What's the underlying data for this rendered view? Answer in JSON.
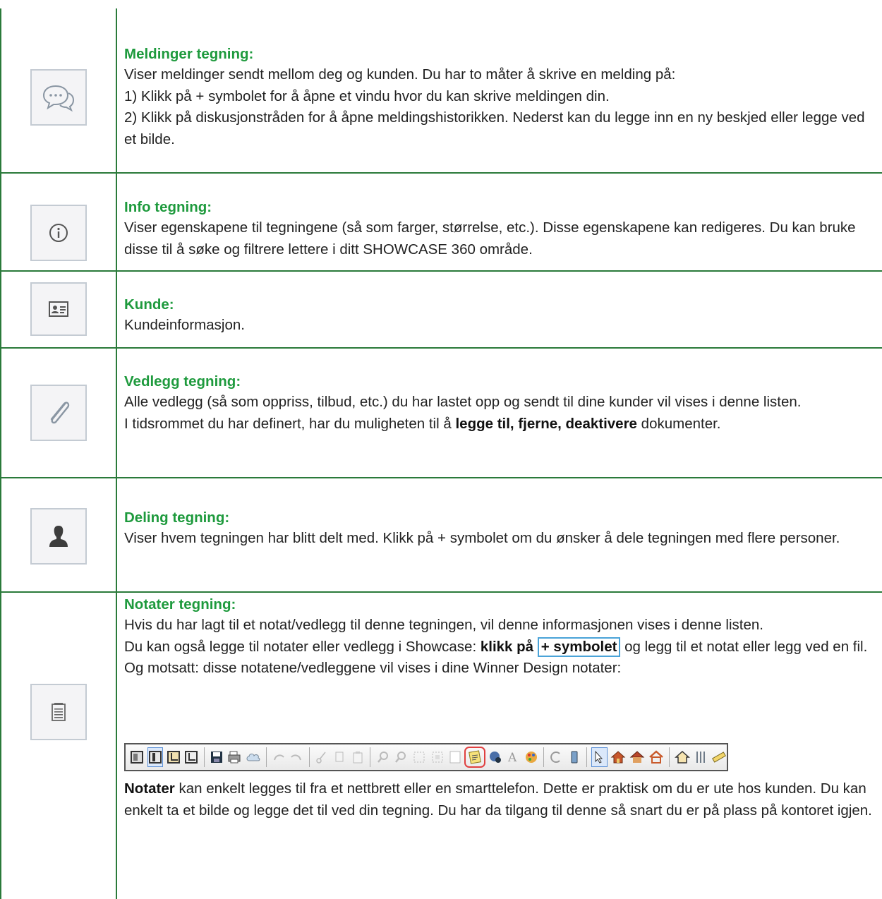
{
  "rows": [
    {
      "icon": "chat-bubbles-icon",
      "heading": "Meldinger tegning:",
      "lines": [
        "Viser meldinger sendt mellom deg og kunden. Du har to måter å skrive en melding på:",
        "1) Klikk på + symbolet for å åpne et vindu hvor du kan skrive meldingen din.",
        "2) Klikk på diskusjonstråden for å åpne meldingshistorikken. Nederst kan du legge inn en ny beskjed eller legge ved et bilde."
      ]
    },
    {
      "icon": "info-icon",
      "heading": "Info tegning:",
      "lines": [
        "Viser egenskapene til tegningene (så som farger, størrelse, etc.). Disse egenskapene kan redigeres. Du kan bruke disse til å søke og filtrere lettere i ditt SHOWCASE 360 område."
      ]
    },
    {
      "icon": "contact-card-icon",
      "heading": "Kunde:",
      "lines": [
        "Kundeinformasjon."
      ]
    },
    {
      "icon": "paperclip-icon",
      "heading": "Vedlegg tegning:",
      "line1": "Alle vedlegg (så som oppriss, tilbud, etc.) du har lastet opp og sendt til dine kunder vil vises i denne listen.",
      "line2_pre": "I tidsrommet du har definert, har du muligheten til å ",
      "line2_bold": "legge til, fjerne, deaktivere",
      "line2_post": " dokumenter."
    },
    {
      "icon": "user-silhouette-icon",
      "heading": "Deling tegning:",
      "lines": [
        "Viser hvem tegningen har blitt delt med. Klikk på + symbolet om du ønsker å dele tegningen med flere personer."
      ]
    },
    {
      "icon": "notepad-icon",
      "heading": "Notater tegning:",
      "line1": "Hvis du har lagt til et notat/vedlegg til denne tegningen, vil denne informasjonen vises i denne listen.",
      "line2_pre": "Du kan også legge til notater eller vedlegg i Showcase: ",
      "line2_bold": "klikk på",
      "line2_boxed": "+ symbolet",
      "line2_post": " og legg til et notat eller legg ved en fil. Og motsatt: disse notatene/vedleggene vil vises i dine Winner Design notater:",
      "bottom_bold": "Notater",
      "bottom_text": " kan enkelt legges til fra et nettbrett eller en smarttelefon. Dette er praktisk om du er ute hos kunden. Du kan enkelt ta et bilde og legge det til ved din tegning. Du har da tilgang til denne så snart du er på plass på kontoret igjen."
    }
  ],
  "toolbar_icons": [
    "view-mode-icon",
    "view-mode-selected-icon",
    "layout-icon",
    "layout-alt-icon",
    "save-icon",
    "print-icon",
    "cloud-icon",
    "undo-icon",
    "redo-icon",
    "cut-icon",
    "copy-icon",
    "paste-icon",
    "zoom-in-icon",
    "zoom-out-icon",
    "grid-icon",
    "grid-alt-icon",
    "frame-icon",
    "notes-icon",
    "info-globe-icon",
    "text-icon",
    "palette-icon",
    "refresh-icon",
    "phone-icon",
    "pointer-icon",
    "house-icon",
    "house-roof-icon",
    "house-frame-icon",
    "house-outline-icon",
    "align-icon",
    "ruler-icon"
  ],
  "colors": {
    "heading": "#1e9a3d",
    "rule": "#2a7a3a",
    "highlight_box": "#4aa3d8",
    "notes_highlight": "#e04040"
  }
}
